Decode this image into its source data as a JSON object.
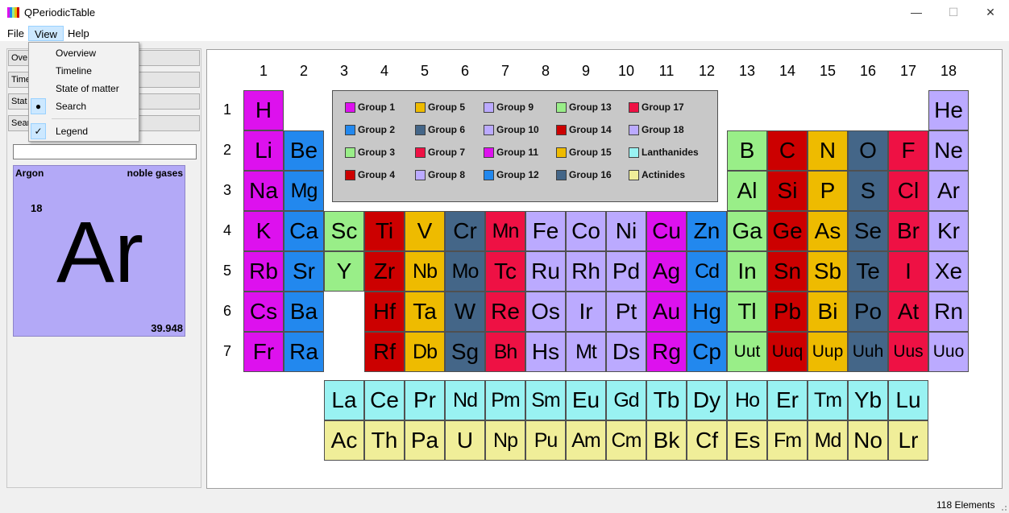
{
  "window": {
    "title": "QPeriodicTable",
    "minimize": "—",
    "maximize": "☐",
    "close": "✕"
  },
  "menu": [
    "File",
    "View",
    "Help"
  ],
  "view_menu": {
    "items": [
      {
        "label": "Overview",
        "mark": ""
      },
      {
        "label": "Timeline",
        "mark": ""
      },
      {
        "label": "State of matter",
        "mark": ""
      },
      {
        "label": "Search",
        "mark": "●"
      },
      {
        "label": "Legend",
        "mark": "✓"
      }
    ]
  },
  "sidebar": {
    "buttons": [
      "Ove",
      "Time",
      "Stat",
      "Sear"
    ],
    "search_value": ""
  },
  "selected_element": {
    "name": "Argon",
    "category": "noble gases",
    "number": "18",
    "symbol": "Ar",
    "mass": "39.948"
  },
  "colors": {
    "g1": "#dd11ee",
    "g2": "#2288ee",
    "g3": "#99ee88",
    "g4": "#cc0000",
    "g5": "#eebb00",
    "g6": "#446688",
    "g7": "#ee1144",
    "g8": "#bbaaff",
    "la": "#99f2f2",
    "ac": "#f0ee99"
  },
  "column_numbers": [
    "1",
    "2",
    "3",
    "4",
    "5",
    "6",
    "7",
    "8",
    "9",
    "10",
    "11",
    "12",
    "13",
    "14",
    "15",
    "16",
    "17",
    "18"
  ],
  "row_numbers": [
    "1",
    "2",
    "3",
    "4",
    "5",
    "6",
    "7"
  ],
  "legend": [
    {
      "label": "Group 1",
      "color": "g1"
    },
    {
      "label": "Group 2",
      "color": "g2"
    },
    {
      "label": "Group 3",
      "color": "g3"
    },
    {
      "label": "Group 4",
      "color": "g4"
    },
    {
      "label": "Group 5",
      "color": "g5"
    },
    {
      "label": "Group 6",
      "color": "g6"
    },
    {
      "label": "Group 7",
      "color": "g7"
    },
    {
      "label": "Group 8",
      "color": "g8"
    },
    {
      "label": "Group 9",
      "color": "g8"
    },
    {
      "label": "Group 10",
      "color": "g8"
    },
    {
      "label": "Group 11",
      "color": "g1"
    },
    {
      "label": "Group 12",
      "color": "g2"
    },
    {
      "label": "Group 13",
      "color": "g3"
    },
    {
      "label": "Group 14",
      "color": "g4"
    },
    {
      "label": "Group 15",
      "color": "g5"
    },
    {
      "label": "Group 16",
      "color": "g6"
    },
    {
      "label": "Group 17",
      "color": "g7"
    },
    {
      "label": "Group 18",
      "color": "g8"
    },
    {
      "label": "Lanthanides",
      "color": "la"
    },
    {
      "label": "Actinides",
      "color": "ac"
    }
  ],
  "elements": [
    {
      "s": "H",
      "p": 1,
      "g": 1
    },
    {
      "s": "He",
      "p": 1,
      "g": 18
    },
    {
      "s": "Li",
      "p": 2,
      "g": 1
    },
    {
      "s": "Be",
      "p": 2,
      "g": 2
    },
    {
      "s": "B",
      "p": 2,
      "g": 13
    },
    {
      "s": "C",
      "p": 2,
      "g": 14
    },
    {
      "s": "N",
      "p": 2,
      "g": 15
    },
    {
      "s": "O",
      "p": 2,
      "g": 16
    },
    {
      "s": "F",
      "p": 2,
      "g": 17
    },
    {
      "s": "Ne",
      "p": 2,
      "g": 18
    },
    {
      "s": "Na",
      "p": 3,
      "g": 1
    },
    {
      "s": "Mg",
      "p": 3,
      "g": 2
    },
    {
      "s": "Al",
      "p": 3,
      "g": 13
    },
    {
      "s": "Si",
      "p": 3,
      "g": 14
    },
    {
      "s": "P",
      "p": 3,
      "g": 15
    },
    {
      "s": "S",
      "p": 3,
      "g": 16
    },
    {
      "s": "Cl",
      "p": 3,
      "g": 17
    },
    {
      "s": "Ar",
      "p": 3,
      "g": 18
    },
    {
      "s": "K",
      "p": 4,
      "g": 1
    },
    {
      "s": "Ca",
      "p": 4,
      "g": 2
    },
    {
      "s": "Sc",
      "p": 4,
      "g": 3
    },
    {
      "s": "Ti",
      "p": 4,
      "g": 4
    },
    {
      "s": "V",
      "p": 4,
      "g": 5
    },
    {
      "s": "Cr",
      "p": 4,
      "g": 6
    },
    {
      "s": "Mn",
      "p": 4,
      "g": 7
    },
    {
      "s": "Fe",
      "p": 4,
      "g": 8
    },
    {
      "s": "Co",
      "p": 4,
      "g": 9
    },
    {
      "s": "Ni",
      "p": 4,
      "g": 10
    },
    {
      "s": "Cu",
      "p": 4,
      "g": 11
    },
    {
      "s": "Zn",
      "p": 4,
      "g": 12
    },
    {
      "s": "Ga",
      "p": 4,
      "g": 13
    },
    {
      "s": "Ge",
      "p": 4,
      "g": 14
    },
    {
      "s": "As",
      "p": 4,
      "g": 15
    },
    {
      "s": "Se",
      "p": 4,
      "g": 16
    },
    {
      "s": "Br",
      "p": 4,
      "g": 17
    },
    {
      "s": "Kr",
      "p": 4,
      "g": 18
    },
    {
      "s": "Rb",
      "p": 5,
      "g": 1
    },
    {
      "s": "Sr",
      "p": 5,
      "g": 2
    },
    {
      "s": "Y",
      "p": 5,
      "g": 3
    },
    {
      "s": "Zr",
      "p": 5,
      "g": 4
    },
    {
      "s": "Nb",
      "p": 5,
      "g": 5
    },
    {
      "s": "Mo",
      "p": 5,
      "g": 6
    },
    {
      "s": "Tc",
      "p": 5,
      "g": 7
    },
    {
      "s": "Ru",
      "p": 5,
      "g": 8
    },
    {
      "s": "Rh",
      "p": 5,
      "g": 9
    },
    {
      "s": "Pd",
      "p": 5,
      "g": 10
    },
    {
      "s": "Ag",
      "p": 5,
      "g": 11
    },
    {
      "s": "Cd",
      "p": 5,
      "g": 12
    },
    {
      "s": "In",
      "p": 5,
      "g": 13
    },
    {
      "s": "Sn",
      "p": 5,
      "g": 14
    },
    {
      "s": "Sb",
      "p": 5,
      "g": 15
    },
    {
      "s": "Te",
      "p": 5,
      "g": 16
    },
    {
      "s": "I",
      "p": 5,
      "g": 17
    },
    {
      "s": "Xe",
      "p": 5,
      "g": 18
    },
    {
      "s": "Cs",
      "p": 6,
      "g": 1
    },
    {
      "s": "Ba",
      "p": 6,
      "g": 2
    },
    {
      "s": "Hf",
      "p": 6,
      "g": 4
    },
    {
      "s": "Ta",
      "p": 6,
      "g": 5
    },
    {
      "s": "W",
      "p": 6,
      "g": 6
    },
    {
      "s": "Re",
      "p": 6,
      "g": 7
    },
    {
      "s": "Os",
      "p": 6,
      "g": 8
    },
    {
      "s": "Ir",
      "p": 6,
      "g": 9
    },
    {
      "s": "Pt",
      "p": 6,
      "g": 10
    },
    {
      "s": "Au",
      "p": 6,
      "g": 11
    },
    {
      "s": "Hg",
      "p": 6,
      "g": 12
    },
    {
      "s": "Tl",
      "p": 6,
      "g": 13
    },
    {
      "s": "Pb",
      "p": 6,
      "g": 14
    },
    {
      "s": "Bi",
      "p": 6,
      "g": 15
    },
    {
      "s": "Po",
      "p": 6,
      "g": 16
    },
    {
      "s": "At",
      "p": 6,
      "g": 17
    },
    {
      "s": "Rn",
      "p": 6,
      "g": 18
    },
    {
      "s": "Fr",
      "p": 7,
      "g": 1
    },
    {
      "s": "Ra",
      "p": 7,
      "g": 2
    },
    {
      "s": "Rf",
      "p": 7,
      "g": 4
    },
    {
      "s": "Db",
      "p": 7,
      "g": 5
    },
    {
      "s": "Sg",
      "p": 7,
      "g": 6
    },
    {
      "s": "Bh",
      "p": 7,
      "g": 7
    },
    {
      "s": "Hs",
      "p": 7,
      "g": 8
    },
    {
      "s": "Mt",
      "p": 7,
      "g": 9
    },
    {
      "s": "Ds",
      "p": 7,
      "g": 10
    },
    {
      "s": "Rg",
      "p": 7,
      "g": 11
    },
    {
      "s": "Cp",
      "p": 7,
      "g": 12
    },
    {
      "s": "Uut",
      "p": 7,
      "g": 13
    },
    {
      "s": "Uuq",
      "p": 7,
      "g": 14
    },
    {
      "s": "Uup",
      "p": 7,
      "g": 15
    },
    {
      "s": "Uuh",
      "p": 7,
      "g": 16
    },
    {
      "s": "Uus",
      "p": 7,
      "g": 17
    },
    {
      "s": "Uuo",
      "p": 7,
      "g": 18
    }
  ],
  "lanthanides": [
    "La",
    "Ce",
    "Pr",
    "Nd",
    "Pm",
    "Sm",
    "Eu",
    "Gd",
    "Tb",
    "Dy",
    "Ho",
    "Er",
    "Tm",
    "Yb",
    "Lu"
  ],
  "actinides": [
    "Ac",
    "Th",
    "Pa",
    "U",
    "Np",
    "Pu",
    "Am",
    "Cm",
    "Bk",
    "Cf",
    "Es",
    "Fm",
    "Md",
    "No",
    "Lr"
  ],
  "status": "118 Elements"
}
